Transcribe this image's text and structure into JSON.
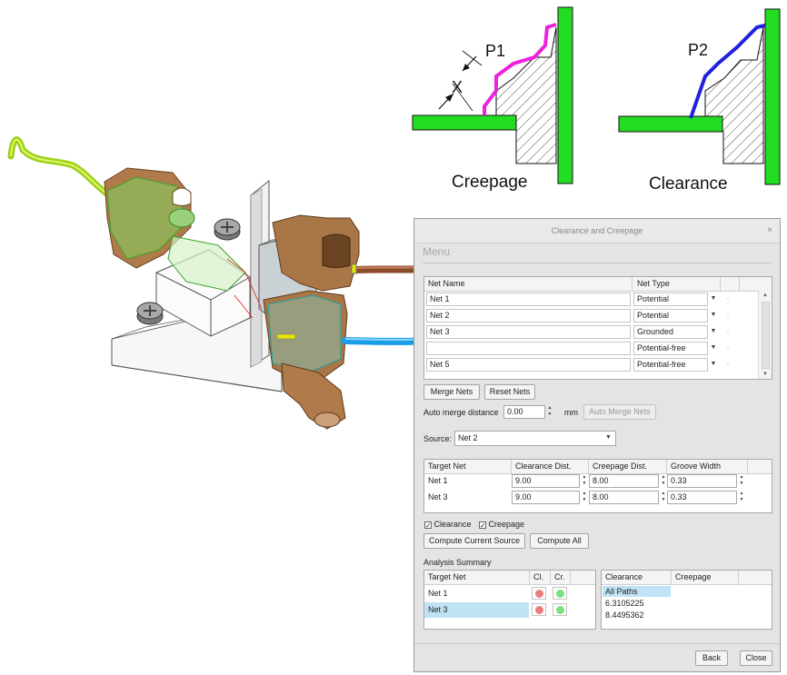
{
  "figure": {
    "creepage_label": "Creepage",
    "clearance_label": "Clearance",
    "p1_label": "P1",
    "p2_label": "P2",
    "x_label": "X",
    "creepage_path_color": "#ee22dd",
    "clearance_path_color": "#2222dd",
    "wall_color": "#22dd22"
  },
  "dialog": {
    "title": "Clearance and Creepage",
    "close_glyph": "×",
    "menu_label": "Menu",
    "nets_table": {
      "headers": [
        "Net Name",
        "Net Type"
      ],
      "rows": [
        {
          "name": "Net 1",
          "type": "Potential"
        },
        {
          "name": "Net 2",
          "type": "Potential"
        },
        {
          "name": "Net 3",
          "type": "Grounded"
        },
        {
          "name": "",
          "type": "Potential-free"
        },
        {
          "name": "Net 5",
          "type": "Potential-free"
        }
      ],
      "dash": "-"
    },
    "merge_nets_label": "Merge Nets",
    "reset_nets_label": "Reset Nets",
    "auto_merge_distance_label": "Auto merge distance",
    "auto_merge_distance_value": "0.00",
    "auto_merge_unit": "mm",
    "auto_merge_nets_label": "Auto Merge Nets",
    "source_label": "Source:",
    "source_value": "Net 2",
    "target_table": {
      "headers": [
        "Target Net",
        "Clearance Dist.",
        "Creepage Dist.",
        "Groove Width"
      ],
      "rows": [
        {
          "net": "Net 1",
          "clearance": "9.00",
          "creepage": "8.00",
          "groove": "0.33"
        },
        {
          "net": "Net 3",
          "clearance": "9.00",
          "creepage": "8.00",
          "groove": "0.33"
        }
      ]
    },
    "clearance_check_label": "Clearance",
    "creepage_check_label": "Creepage",
    "compute_current_label": "Compute Current Source",
    "compute_all_label": "Compute All",
    "analysis_summary_label": "Analysis Summary",
    "summary_table": {
      "headers": [
        "Target Net",
        "Cl.",
        "Cr."
      ],
      "rows": [
        {
          "net": "Net 1",
          "cl": "red",
          "cr": "green"
        },
        {
          "net": "Net 3",
          "cl": "red",
          "cr": "green",
          "selected": true
        }
      ]
    },
    "paths_table": {
      "headers": [
        "Clearance",
        "Creepage"
      ],
      "rows": [
        "All Paths",
        "6.3105225",
        "8.4495362"
      ]
    },
    "back_label": "Back",
    "close_label": "Close",
    "colors": {
      "status_red": "#f07b7b",
      "status_green": "#7ee07e",
      "selection": "#bfe3f5"
    }
  }
}
